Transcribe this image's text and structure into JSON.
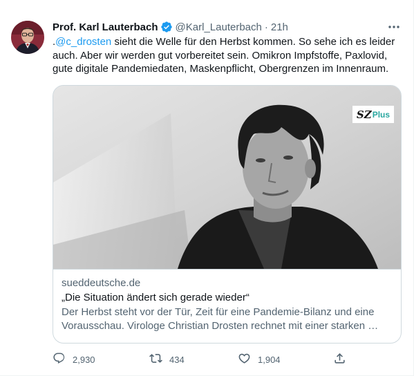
{
  "tweet": {
    "author_name": "Prof. Karl Lauterbach",
    "handle": "@Karl_Lauterbach",
    "separator": "·",
    "time": "21h",
    "text_prefix": ".",
    "mention": "@c_drosten",
    "text_body": " sieht die Welle für den Herbst kommen. So sehe ich es leider auch. Aber wir werden gut vorbereitet sein. Omikron Impfstoffe, Paxlovid, gute digitale Pandemiedaten, Maskenpflicht, Obergrenzen im Innenraum.",
    "verified_icon": "verified-badge-icon",
    "accent_color": "#1d9bf0"
  },
  "card": {
    "domain": "sueddeutsche.de",
    "title": "„Die Situation ändert sich gerade wieder“",
    "description": "Der Herbst steht vor der Tür, Zeit für eine Pandemie-Bilanz und eine Vorausschau. Virologe Christian Drosten rechnet mit einer starken …",
    "badge_sz": "SZ",
    "badge_plus": "Plus"
  },
  "actions": {
    "reply_count": "2,930",
    "retweet_count": "434",
    "like_count": "1,904",
    "reply_icon": "reply-icon",
    "retweet_icon": "retweet-icon",
    "like_icon": "heart-icon",
    "share_icon": "share-icon"
  }
}
